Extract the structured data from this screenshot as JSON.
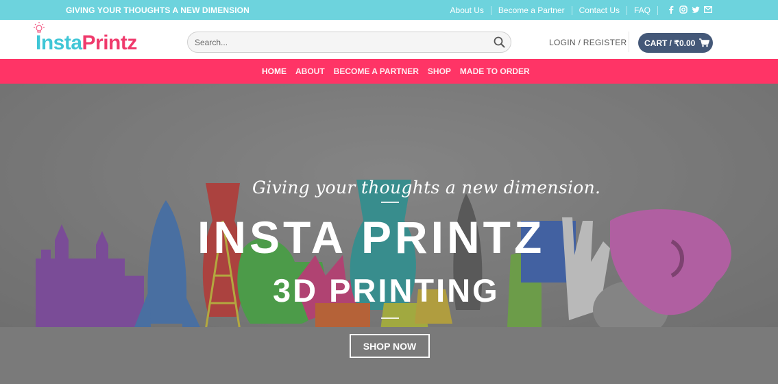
{
  "topbar": {
    "tagline": "GIVING YOUR THOUGHTS A NEW DIMENSION",
    "links": [
      "About Us",
      "Become a Partner",
      "Contact Us",
      "FAQ"
    ],
    "social_icons": [
      "facebook-icon",
      "instagram-icon",
      "twitter-icon",
      "envelope-icon"
    ]
  },
  "header": {
    "logo_part1": "Insta",
    "logo_part2": "Printz",
    "search_placeholder": "Search...",
    "login_label": "LOGIN / REGISTER",
    "cart_label": "CART / ₹0.00"
  },
  "nav": {
    "items": [
      "HOME",
      "ABOUT",
      "BECOME A PARTNER",
      "SHOP",
      "MADE TO ORDER"
    ]
  },
  "hero": {
    "script_text": "Giving your thoughts a new dimension.",
    "title": "INSTA PRINTZ",
    "subtitle": "3D PRINTING",
    "button_label": "SHOP NOW"
  },
  "colors": {
    "topbar_bg": "#6dd3dd",
    "nav_bg": "#ff3466",
    "cart_bg": "#445878",
    "logo_teal": "#3fc6d6",
    "logo_pink": "#ef3a6c"
  }
}
